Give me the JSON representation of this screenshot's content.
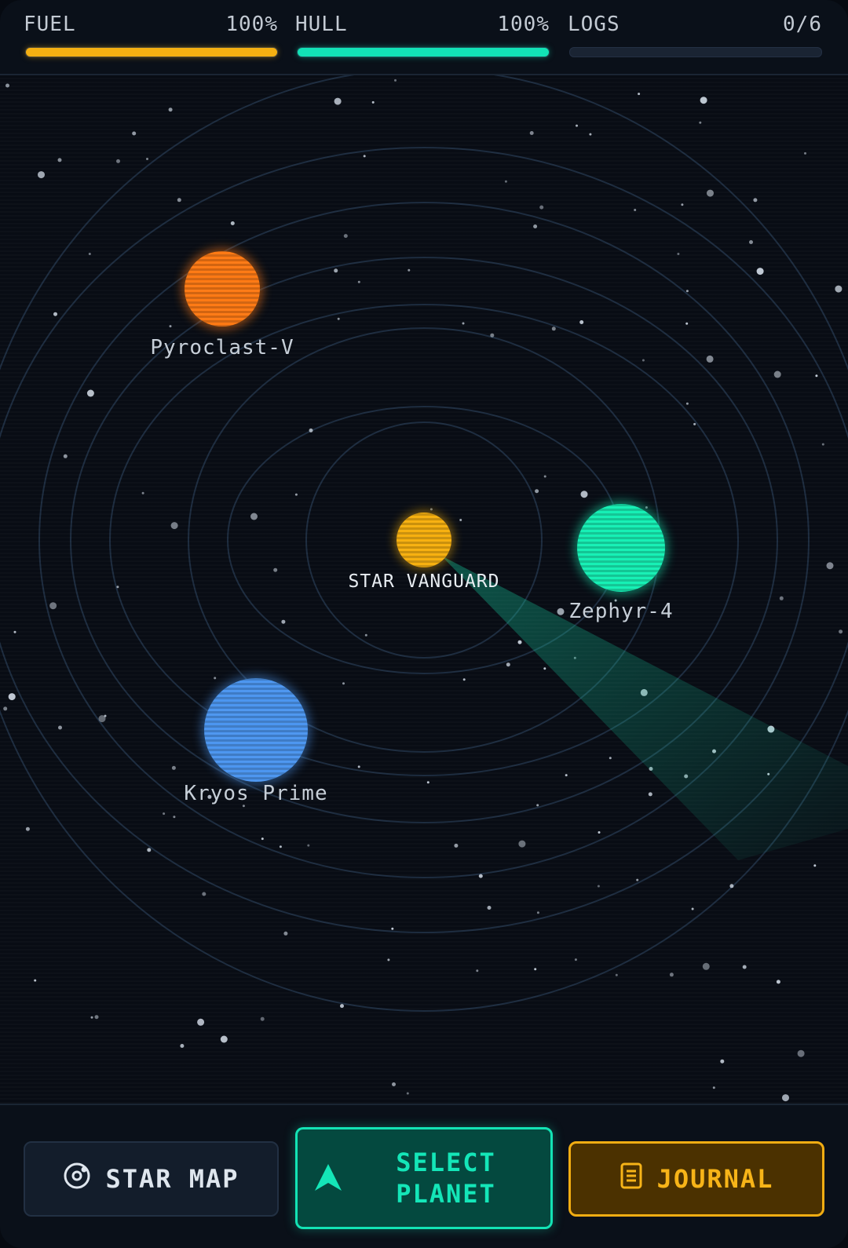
{
  "hud": {
    "fuel": {
      "label": "FUEL",
      "value_text": "100%",
      "level": 1.0,
      "color": "#f5b012"
    },
    "hull": {
      "label": "HULL",
      "value_text": "100%",
      "level": 1.0,
      "color": "#12e3b6"
    },
    "logs": {
      "label": "LOGS",
      "value_text": "0/6",
      "level": 0.0,
      "color": "#5a6b84"
    }
  },
  "map": {
    "ship": {
      "label": "STAR VANGUARD",
      "color": "#f7b00f"
    },
    "planets": [
      {
        "name": "Pyroclast-V",
        "color": "#ff7a14"
      },
      {
        "name": "Zephyr-4",
        "color": "#16f0b5"
      },
      {
        "name": "Kryos Prime",
        "color": "#4c96f0"
      }
    ]
  },
  "actions": {
    "star_map": {
      "label": "STAR MAP",
      "icon": "orbit-icon"
    },
    "select_planet": {
      "label": "SELECT\nPLANET",
      "icon": "arrow-up-icon"
    },
    "journal": {
      "label": "JOURNAL",
      "icon": "journal-icon"
    }
  }
}
